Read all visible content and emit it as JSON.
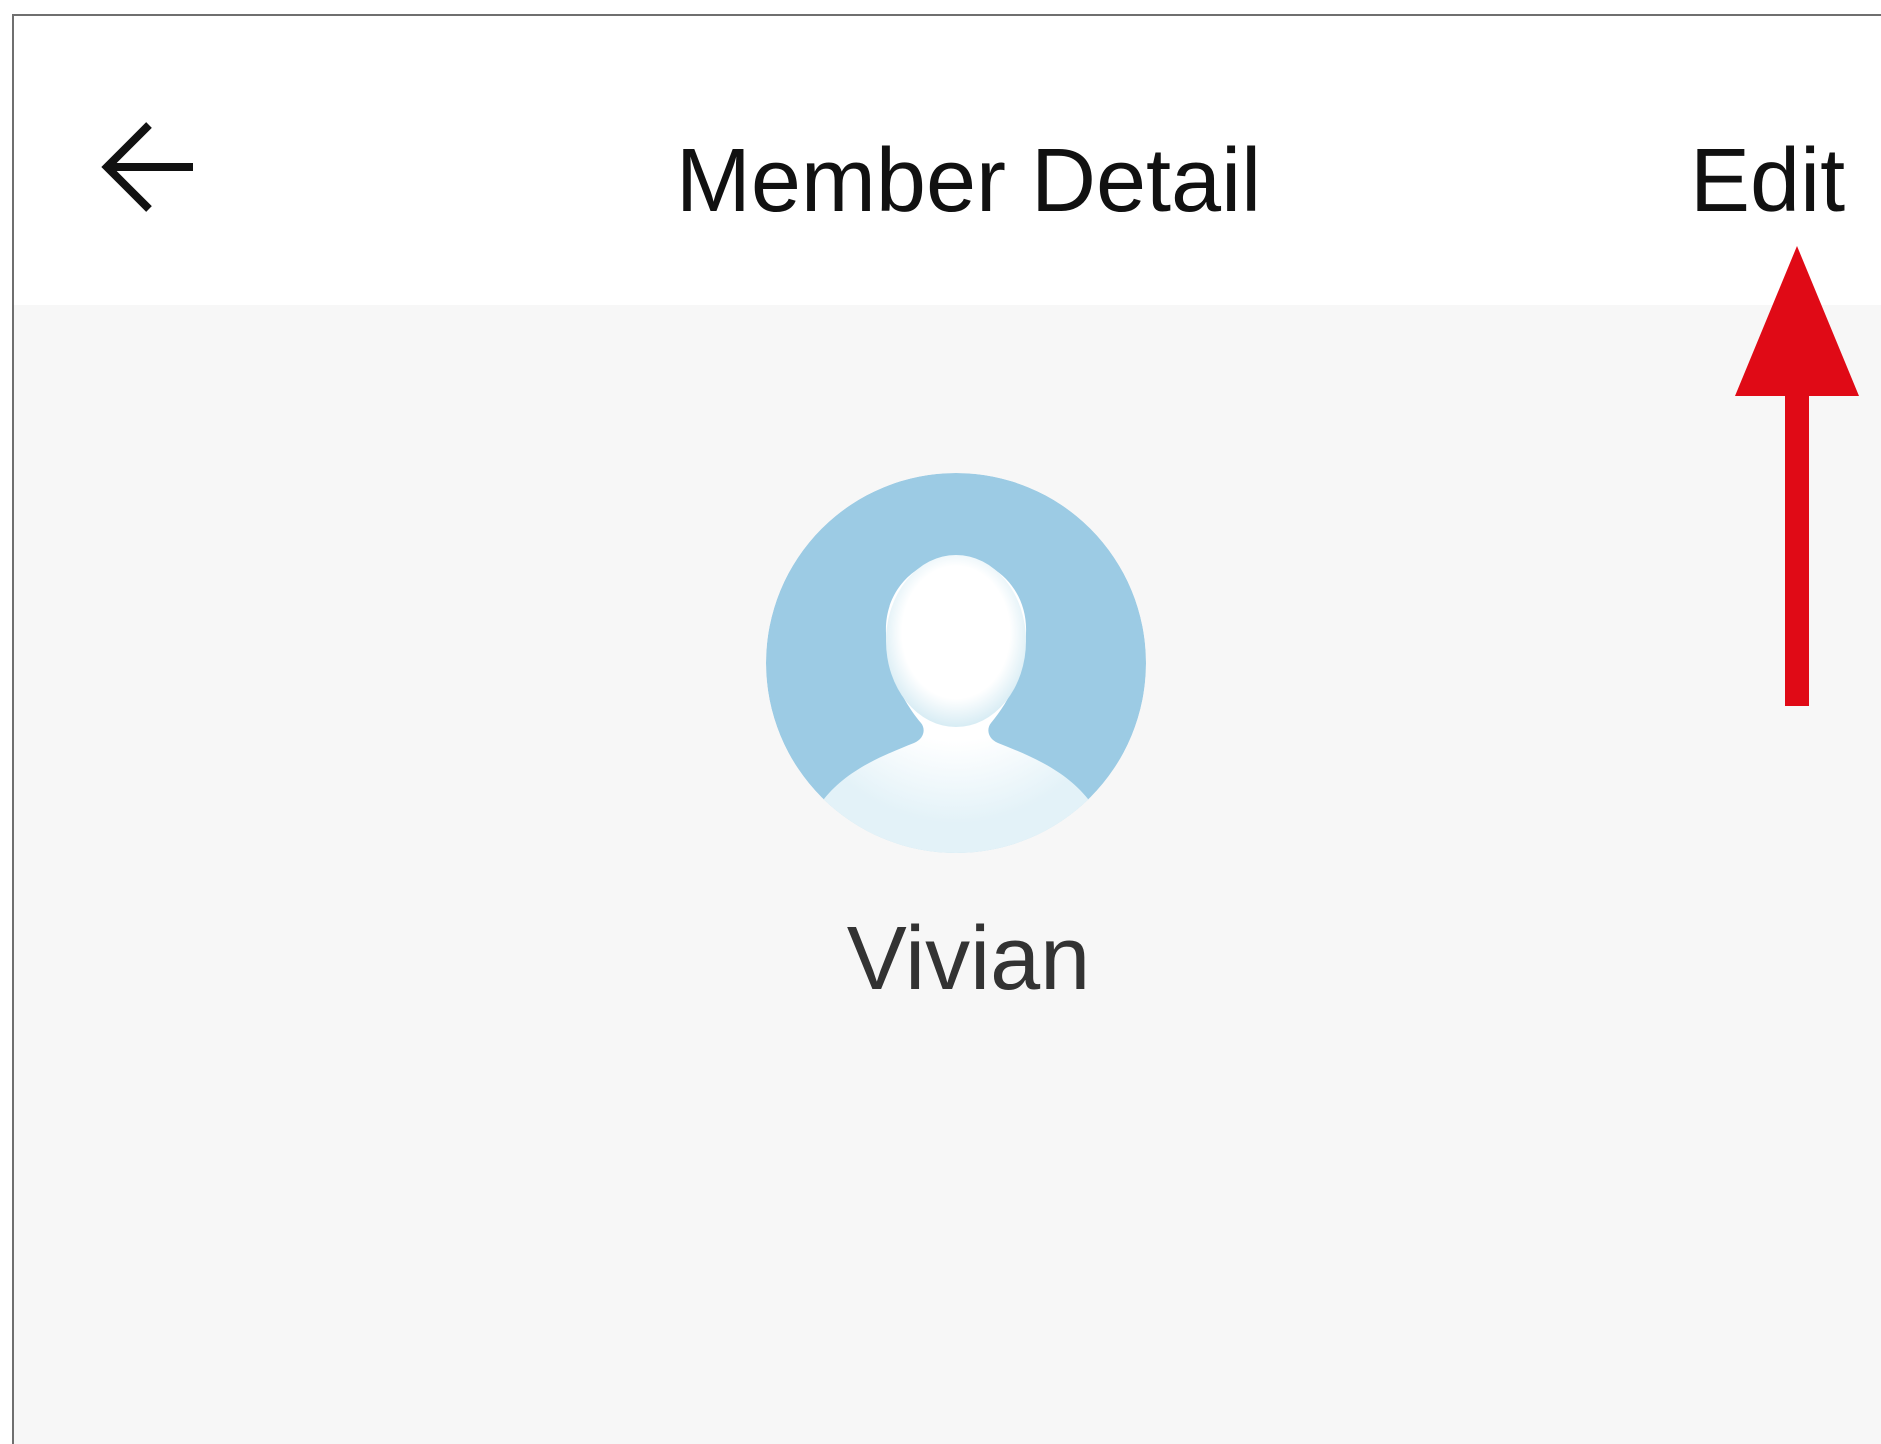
{
  "header": {
    "title": "Member Detail",
    "edit_label": "Edit",
    "back_icon": "back-arrow-icon"
  },
  "member": {
    "name": "Vivian",
    "avatar_icon": "default-avatar-icon"
  },
  "annotation": {
    "arrow_icon": "red-arrow-pointer-icon",
    "arrow_color": "#e00a16"
  },
  "colors": {
    "header_background": "#ffffff",
    "page_background": "#f7f7f7",
    "avatar_background": "#9ccbe4",
    "title_text": "#111111",
    "name_text": "#333333"
  }
}
